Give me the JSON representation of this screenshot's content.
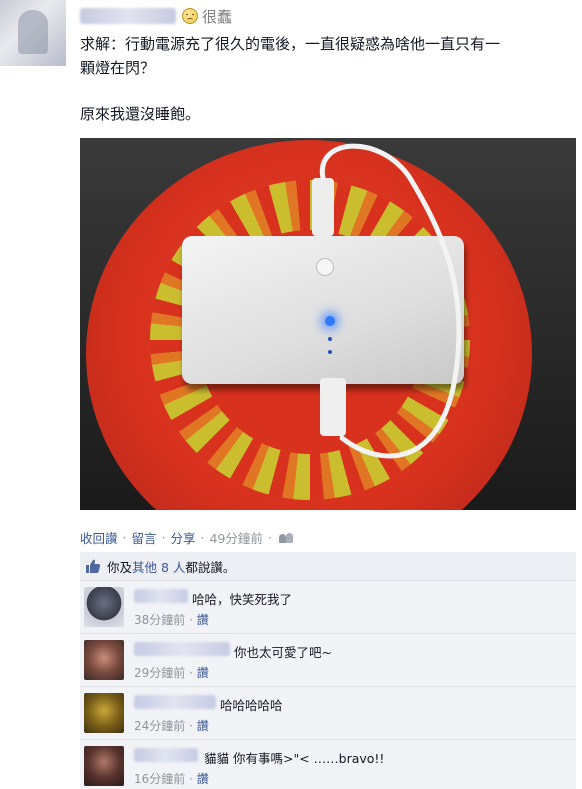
{
  "post": {
    "feeling": "很蠢",
    "line1": "求解：行動電源充了很久的電後，一直很疑惑為啥他一直只有一",
    "line2": "顆燈在閃？",
    "line3": "原來我還沒睡飽。"
  },
  "actions": {
    "unlike": "收回讚",
    "comment": "留言",
    "share": "分享",
    "time": "49分鐘前",
    "dot": "·"
  },
  "likes": {
    "prefix": "你及",
    "others": "其他 8 人",
    "suffix": "都說讚。"
  },
  "comments": [
    {
      "text": "哈哈，快笑死我了",
      "time": "38分鐘前",
      "like": "讚"
    },
    {
      "text": "你也太可愛了吧~",
      "time": "29分鐘前",
      "like": "讚"
    },
    {
      "text": "哈哈哈哈哈",
      "time": "24分鐘前",
      "like": "讚"
    },
    {
      "text": "貓貓  你有事嗎>\"<  ……bravo!!",
      "time": "16分鐘前",
      "like": "讚"
    }
  ],
  "colors": {
    "link": "#3b5998",
    "meta": "#90949c",
    "comment_bg": "#f2f3f6",
    "likes_bg": "#edeff4"
  },
  "icons": {
    "feeling": "frowning-face-icon",
    "like": "thumbs-up-icon",
    "audience": "friends-icon"
  }
}
